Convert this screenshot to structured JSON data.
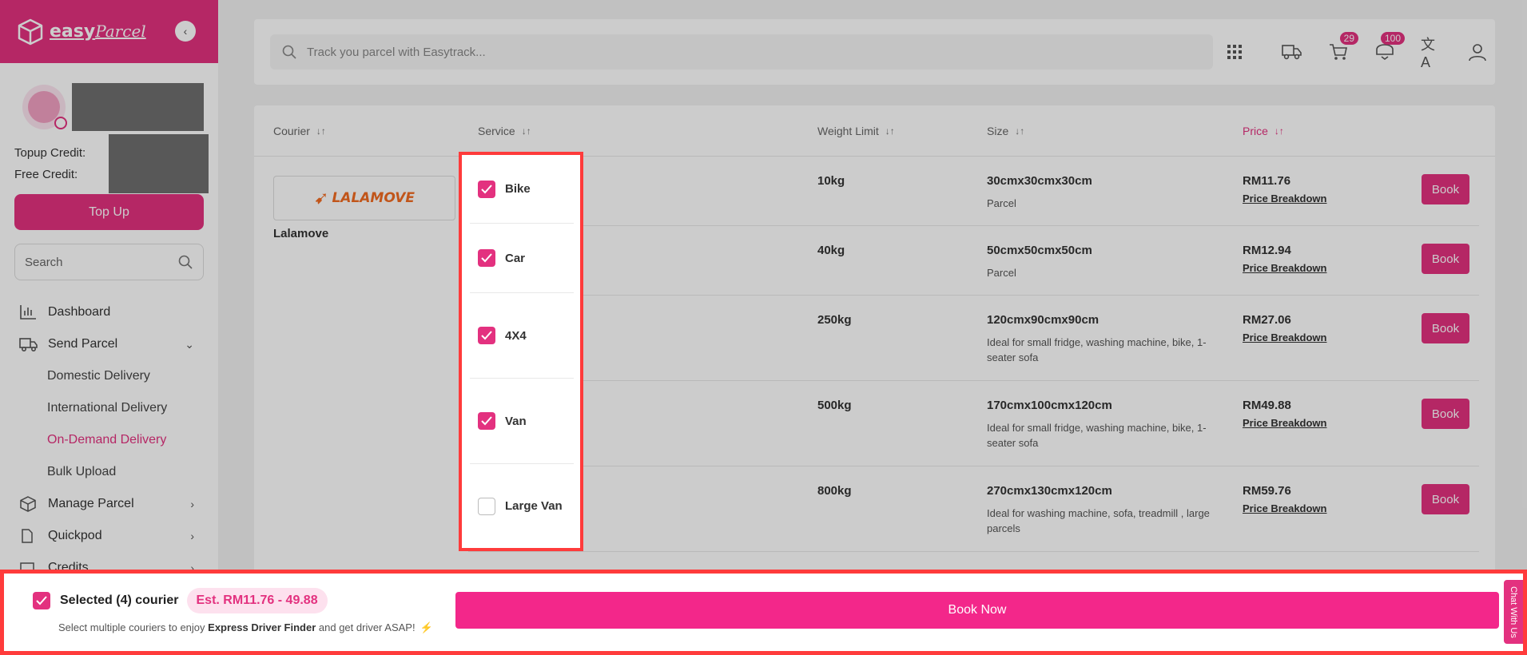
{
  "brand": {
    "name_bold": "easy",
    "name_script": "Parcel"
  },
  "sidebar": {
    "credits": {
      "topup_label": "Topup Credit:",
      "free_label": "Free Credit:"
    },
    "topup_button": "Top Up",
    "search_placeholder": "Search",
    "nav": [
      {
        "label": "Dashboard",
        "icon": "chart-icon"
      },
      {
        "label": "Send Parcel",
        "icon": "truck-icon"
      },
      {
        "label": "Domestic Delivery"
      },
      {
        "label": "International Delivery"
      },
      {
        "label": "On-Demand Delivery",
        "active": true
      },
      {
        "label": "Bulk Upload"
      },
      {
        "label": "Manage Parcel",
        "icon": "box-icon"
      },
      {
        "label": "Quickpod"
      },
      {
        "label": "Credits"
      }
    ]
  },
  "topbar": {
    "track_placeholder": "Track you parcel with Easytrack...",
    "cart_count": "29",
    "notif_count": "100"
  },
  "table": {
    "headers": {
      "courier": "Courier",
      "service": "Service",
      "weight": "Weight Limit",
      "size": "Size",
      "price": "Price"
    },
    "courier_logo": "LALAMOVE",
    "courier_name": "Lalamove",
    "price_breakdown_label": "Price Breakdown",
    "book_label": "Book",
    "rows": [
      {
        "service": "Bike",
        "checked": true,
        "weight": "10kg",
        "size": "30cmx30cmx30cm",
        "desc": "Parcel",
        "price": "RM11.76"
      },
      {
        "service": "Car",
        "checked": true,
        "weight": "40kg",
        "size": "50cmx50cmx50cm",
        "desc": "Parcel",
        "price": "RM12.94"
      },
      {
        "service": "4X4",
        "checked": true,
        "weight": "250kg",
        "size": "120cmx90cmx90cm",
        "desc": "Ideal for small fridge, washing machine, bike, 1-seater sofa",
        "price": "RM27.06"
      },
      {
        "service": "Van",
        "checked": true,
        "weight": "500kg",
        "size": "170cmx100cmx120cm",
        "desc": "Ideal for small fridge, washing machine, bike, 1-seater sofa",
        "price": "RM49.88"
      },
      {
        "service": "Large Van",
        "checked": false,
        "weight": "800kg",
        "size": "270cmx130cmx120cm",
        "desc": "Ideal for washing machine, sofa, treadmill , large parcels",
        "price": "RM59.76"
      }
    ]
  },
  "bottom": {
    "selected_text": "Selected (4) courier",
    "estimate": "Est. RM11.76 - 49.88",
    "hint_pre": "Select multiple couriers to enjoy ",
    "hint_bold": "Express Driver Finder",
    "hint_post": " and get driver ASAP!",
    "book_now": "Book Now",
    "chat_tab": "Chat With Us"
  },
  "colors": {
    "accent": "#e3317f",
    "highlight": "#ff3b3b"
  }
}
